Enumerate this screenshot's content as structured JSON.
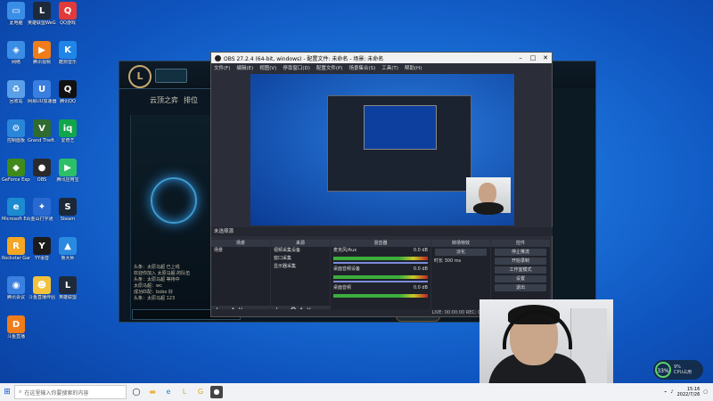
{
  "desktop_icons": [
    {
      "label": "此电脑",
      "color": "#3a8ee6",
      "glyph": "▭"
    },
    {
      "label": "英雄联盟WeGame版",
      "color": "#1e2a3a",
      "glyph": "L"
    },
    {
      "label": "QQ游戏",
      "color": "#e23a3a",
      "glyph": "Q"
    },
    {
      "label": "网络",
      "color": "#3a8ee6",
      "glyph": "◈"
    },
    {
      "label": "腾讯视频",
      "color": "#f07c1a",
      "glyph": "▶"
    },
    {
      "label": "酷狗音乐",
      "color": "#1f86e8",
      "glyph": "K"
    },
    {
      "label": "回收站",
      "color": "#5aa0e8",
      "glyph": "♻"
    },
    {
      "label": "网易UU加速器",
      "color": "#3a7ee0",
      "glyph": "U"
    },
    {
      "label": "腾讯QQ",
      "color": "#111",
      "glyph": "Q"
    },
    {
      "label": "控制面板",
      "color": "#2a86d8",
      "glyph": "⚙"
    },
    {
      "label": "Grand Theft Auto V",
      "color": "#2f6b2f",
      "glyph": "V"
    },
    {
      "label": "爱奇艺",
      "color": "#12a64a",
      "glyph": "iq"
    },
    {
      "label": "GeForce Experience",
      "color": "#3f8a1b",
      "glyph": "◆"
    },
    {
      "label": "OBS",
      "color": "#2a2a2a",
      "glyph": "●"
    },
    {
      "label": "腾讯应用宝",
      "color": "#2dbf67",
      "glyph": "▶"
    },
    {
      "label": "Microsoft Edge",
      "color": "#1d8bd0",
      "glyph": "e"
    },
    {
      "label": "金山打字通",
      "color": "#2a6ad0",
      "glyph": "✦"
    },
    {
      "label": "Steam",
      "color": "#1b2838",
      "glyph": "S"
    },
    {
      "label": "Rockstar Games",
      "color": "#f5a623",
      "glyph": "R"
    },
    {
      "label": "YY语音",
      "color": "#1b1b1b",
      "glyph": "Y"
    },
    {
      "label": "鲁大师",
      "color": "#2a8ae0",
      "glyph": "▲"
    },
    {
      "label": "腾讯会议",
      "color": "#3a80e0",
      "glyph": "◉"
    },
    {
      "label": "斗鱼直播伴侣",
      "color": "#f4c23a",
      "glyph": "☻"
    },
    {
      "label": "英雄联盟",
      "color": "#1e2a3a",
      "glyph": "L"
    },
    {
      "label": "斗鱼直播",
      "color": "#f07c1a",
      "glyph": "D"
    }
  ],
  "lol": {
    "nav": [
      "云顶之弈",
      "排位"
    ],
    "chat": [
      "头条：太原马超 已上线",
      "欢迎你加入 太原马超 的队伍",
      "头条：太原马超 等待中",
      "太原马超：wc",
      "成功匹配：bobo 好",
      "头条：太原马超 123"
    ],
    "button": "确认"
  },
  "obs": {
    "title": "OBS 27.2.4 (64-bit, windows) - 配置文件: 未命名 - 场景: 未命名",
    "menu": [
      "文件(F)",
      "编辑(E)",
      "视图(V)",
      "停靠窗口(D)",
      "配置文件(P)",
      "场景集合(S)",
      "工具(T)",
      "帮助(H)"
    ],
    "scene_label": "未选择源",
    "docks": {
      "scenes": {
        "title": "场景",
        "items": [
          "场景"
        ]
      },
      "sources": {
        "title": "来源",
        "items": [
          "视频采集设备",
          "窗口采集",
          "显示器采集"
        ]
      },
      "mixer": {
        "title": "混音器",
        "channels": [
          {
            "name": "麦克风/Aux",
            "db": "0.0 dB"
          },
          {
            "name": "桌面音频设备",
            "db": "0.0 dB"
          },
          {
            "name": "桌面音频",
            "db": "0.0 dB"
          }
        ]
      },
      "transitions": {
        "title": "转场特效",
        "type": "淡化",
        "duration_label": "时长",
        "duration": "300 ms"
      },
      "controls": {
        "title": "控件",
        "buttons": [
          "停止推流",
          "开始录制",
          "工作室模式",
          "设置",
          "退出"
        ]
      }
    },
    "status": "LIVE: 00:00:00   REC: 00:00:00   CPU: 0.5%, 60.00 fps"
  },
  "taskbar": {
    "search_placeholder": "在这里输入你要搜索的内容",
    "time": "15:16",
    "date": "2022/7/26"
  },
  "cpu": {
    "percent": "33%",
    "temp": "9%",
    "label": "CPU占用"
  }
}
